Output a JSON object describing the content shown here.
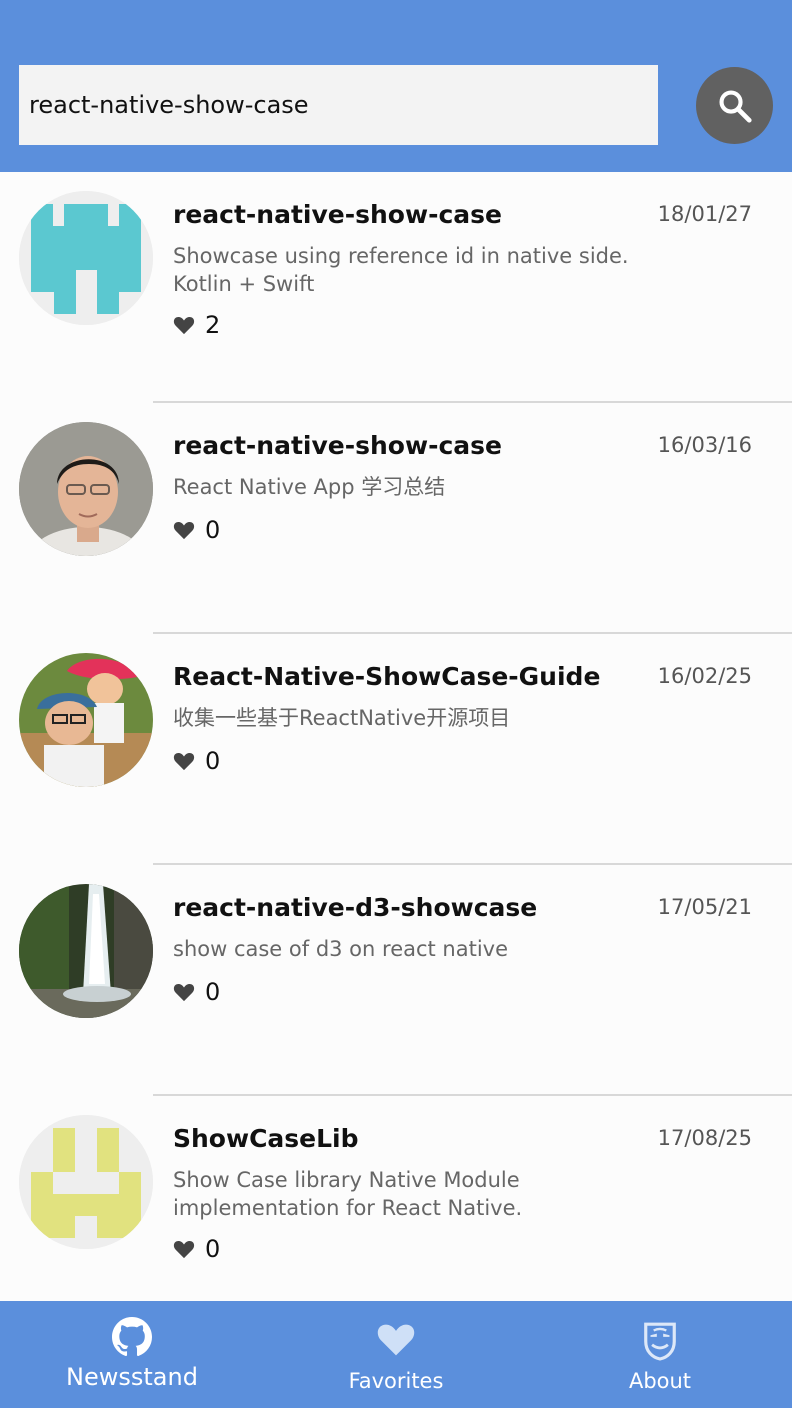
{
  "search": {
    "value": "react-native-show-case",
    "placeholder": ""
  },
  "results": [
    {
      "title": "react-native-show-case",
      "date": "18/01/27",
      "description": "Showcase using reference id in native side. Kotlin + Swift",
      "likes": "2",
      "avatar": "identicon-teal"
    },
    {
      "title": "react-native-show-case",
      "date": "16/03/16",
      "description": "React Native App 学习总结",
      "likes": "0",
      "avatar": "photo-man-glasses"
    },
    {
      "title": "React-Native-ShowCase-Guide",
      "date": "16/02/25",
      "description": "收集一些基于ReactNative开源项目",
      "likes": "0",
      "avatar": "photo-parent-child"
    },
    {
      "title": "react-native-d3-showcase",
      "date": "17/05/21",
      "description": "show case of d3 on react native",
      "likes": "0",
      "avatar": "photo-waterfall"
    },
    {
      "title": "ShowCaseLib",
      "date": "17/08/25",
      "description": "Show Case library Native Module implementation for React Native.",
      "likes": "0",
      "avatar": "identicon-yellow"
    }
  ],
  "tabs": [
    {
      "label": "Newsstand",
      "icon": "github-icon"
    },
    {
      "label": "Favorites",
      "icon": "heart-icon"
    },
    {
      "label": "About",
      "icon": "mask-icon"
    }
  ],
  "colors": {
    "header": "#5b8fdc",
    "tabbar": "#5b8fdc",
    "search_button": "#616161",
    "identicon_teal": "#5bc8d0",
    "identicon_yellow": "#e1e27f"
  }
}
